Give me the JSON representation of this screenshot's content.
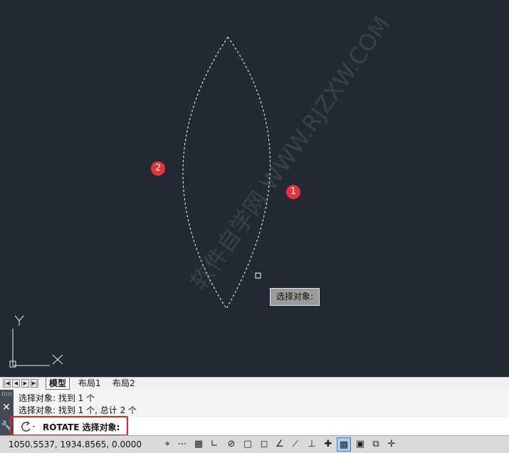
{
  "canvas": {
    "markers": [
      "1",
      "2"
    ],
    "tooltip": "选择对象:",
    "ucs": {
      "y_label": "Y",
      "x_label": "X"
    },
    "watermark": "软件自学网 WWW.RJZXW.COM",
    "colors": {
      "background": "#242a33",
      "selection": "#ffffff",
      "marker": "#e8333d"
    }
  },
  "tabs": {
    "nav_icons": [
      "first-icon",
      "prev-icon",
      "next-icon",
      "last-icon"
    ],
    "items": [
      "模型",
      "布局1",
      "布局2"
    ],
    "active": "模型"
  },
  "command": {
    "history": [
      "选择对象: 找到 1 个",
      "选择对象: 找到 1 个, 总计 2 个"
    ],
    "prompt": "ROTATE 选择对象:",
    "icon": "rotate-icon",
    "highlight_color": "#e02525"
  },
  "status": {
    "coordinates": "1050.5537, 1934.8565, 0.0000",
    "toggles": [
      {
        "icon": "infer-constraints-icon",
        "on": false
      },
      {
        "icon": "snap-icon",
        "on": false
      },
      {
        "icon": "grid-icon",
        "on": false
      },
      {
        "icon": "ortho-icon",
        "on": false
      },
      {
        "icon": "polar-icon",
        "on": false
      },
      {
        "icon": "osnap-icon",
        "on": false
      },
      {
        "icon": "3d-osnap-icon",
        "on": false
      },
      {
        "icon": "otrack-icon",
        "on": false
      },
      {
        "icon": "ducs-icon",
        "on": false
      },
      {
        "icon": "dyn-icon",
        "on": false
      },
      {
        "icon": "lineweight-icon",
        "on": false
      },
      {
        "icon": "transparency-icon",
        "on": true
      },
      {
        "icon": "quick-properties-icon",
        "on": false
      },
      {
        "icon": "selection-cycling-icon",
        "on": false
      },
      {
        "icon": "annotation-monitor-icon",
        "on": false
      }
    ]
  }
}
